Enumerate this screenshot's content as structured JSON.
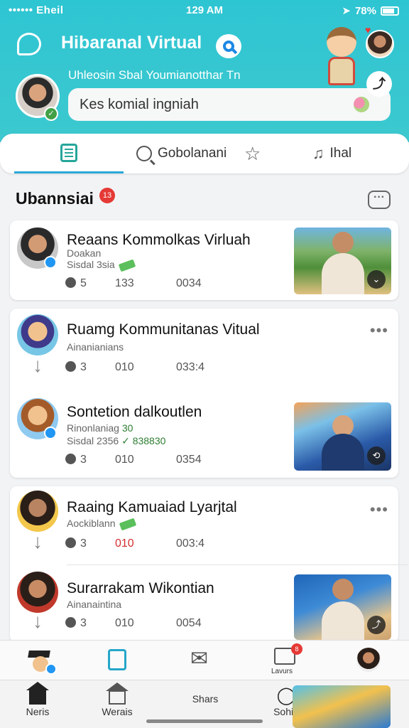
{
  "status_bar": {
    "carrier": "•••••• Eheil",
    "time": "129 AM",
    "battery": "78%"
  },
  "header": {
    "app_title": "Hibaranal Virtual",
    "subtitle": "Uhleosin Sbal Youmianotthar Tn",
    "search_placeholder": "Kes komial ingniah"
  },
  "tabs": [
    {
      "label": ""
    },
    {
      "label": "Gobolanani"
    },
    {
      "label": ""
    },
    {
      "label": "Ihal"
    }
  ],
  "section": {
    "title": "Ubannsiai",
    "badge": "13"
  },
  "posts": [
    {
      "name": "Reaans Kommolkas Virluah",
      "meta1": "Doakan",
      "meta2_prefix": "Sisdal 3sia",
      "meta2_green": "",
      "comments": "5",
      "likes": "133",
      "time": "0034"
    },
    {
      "name": "Ruamg Kommunitanas Vitual",
      "meta1": "Ainanianians",
      "meta2_prefix": "",
      "meta2_green": "",
      "comments": "3",
      "likes": "010",
      "time": "033:4"
    },
    {
      "name": "Sontetion dalkoutlen",
      "meta1": "Rinonlaniag",
      "meta1_green": "30",
      "meta2_prefix": "Sisdal 2356",
      "meta2_green": "838830",
      "comments": "3",
      "likes": "010",
      "time": "0354"
    },
    {
      "name": "Raaing Kamuaiad Lyarjtal",
      "meta1": "Aockiblann",
      "meta2_prefix": "",
      "meta2_green": "",
      "comments": "3",
      "likes": "010",
      "time": "003:4"
    },
    {
      "name": "Surarrakam Wikontian",
      "meta1": "Ainanaintina",
      "meta2_prefix": "",
      "meta2_green": "",
      "comments": "3",
      "likes": "010",
      "time": "0054"
    }
  ],
  "toolbar": {
    "presenter_label": "Lavurs",
    "presenter_badge": "8"
  },
  "bottom_nav": [
    {
      "label": "Neris"
    },
    {
      "label": "Werais"
    },
    {
      "label": "Shars"
    },
    {
      "label": "Sohia"
    }
  ],
  "colors": {
    "header": "#2ec5d3",
    "accent": "#2aa8d8",
    "badge": "#e53935",
    "green": "#2e7d32"
  }
}
